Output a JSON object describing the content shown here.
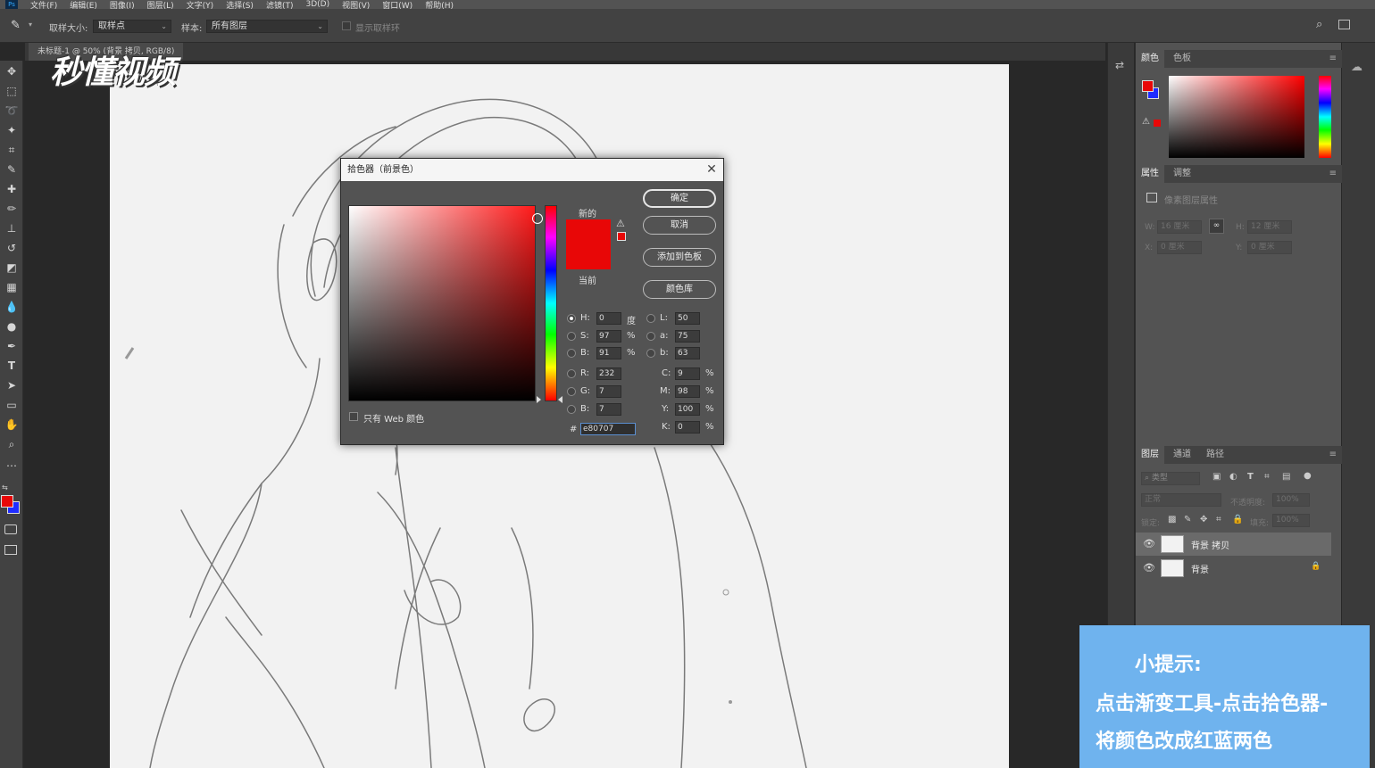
{
  "menubar": {
    "items": [
      "文件(F)",
      "编辑(E)",
      "图像(I)",
      "图层(L)",
      "文字(Y)",
      "选择(S)",
      "滤镜(T)",
      "3D(D)",
      "视图(V)",
      "窗口(W)",
      "帮助(H)"
    ]
  },
  "options_bar": {
    "sample_size_label": "取样大小:",
    "sample_size_value": "取样点",
    "sample_label": "样本:",
    "sample_value": "所有图层",
    "show_ring_label": "显示取样环"
  },
  "document": {
    "tab_label": "未标题-1 @ 50% (背景 拷贝, RGB/8)"
  },
  "watermark": {
    "text": "秒懂视频"
  },
  "color_picker": {
    "title": "拾色器（前景色）",
    "new_label": "新的",
    "current_label": "当前",
    "buttons": {
      "ok": "确定",
      "cancel": "取消",
      "add_to_swatches": "添加到色板",
      "color_libraries": "颜色库"
    },
    "only_web_colors_label": "只有 Web 颜色",
    "fields": {
      "H": {
        "label": "H:",
        "value": "0",
        "unit": "度"
      },
      "S": {
        "label": "S:",
        "value": "97",
        "unit": "%"
      },
      "B": {
        "label": "B:",
        "value": "91",
        "unit": "%"
      },
      "R": {
        "label": "R:",
        "value": "232"
      },
      "G": {
        "label": "G:",
        "value": "7"
      },
      "Bl": {
        "label": "B:",
        "value": "7"
      },
      "L": {
        "label": "L:",
        "value": "50"
      },
      "a": {
        "label": "a:",
        "value": "75"
      },
      "b": {
        "label": "b:",
        "value": "63"
      },
      "C": {
        "label": "C:",
        "value": "9",
        "unit": "%"
      },
      "M": {
        "label": "M:",
        "value": "98",
        "unit": "%"
      },
      "Y": {
        "label": "Y:",
        "value": "100",
        "unit": "%"
      },
      "K": {
        "label": "K:",
        "value": "0",
        "unit": "%"
      },
      "hex": {
        "label": "#",
        "value": "e80707"
      }
    },
    "selected_color": "#e80707"
  },
  "panels": {
    "color": {
      "tabs": [
        "颜色",
        "色板"
      ]
    },
    "properties": {
      "tabs": [
        "属性",
        "调整"
      ],
      "title": "像素图层属性",
      "w_label": "W:",
      "w_value": "16 厘米",
      "h_label": "H:",
      "h_value": "12 厘米",
      "x_label": "X:",
      "x_value": "0 厘米",
      "y_label": "Y:",
      "y_value": "0 厘米"
    },
    "layers": {
      "tabs": [
        "图层",
        "通道",
        "路径"
      ],
      "filter_label": "类型",
      "blend_mode": "正常",
      "opacity_label": "不透明度:",
      "opacity_value": "100%",
      "lock_label": "锁定:",
      "fill_label": "填充:",
      "fill_value": "100%",
      "items": [
        {
          "name": "背景 拷贝"
        },
        {
          "name": "背景"
        }
      ]
    }
  },
  "hint": {
    "title": "小提示:",
    "line1": "点击渐变工具-点击拾色器-",
    "line2": "将颜色改成红蓝两色"
  },
  "colors": {
    "foreground": "#e80707",
    "background": "#1f2cff",
    "hint_bg": "#6fb3ee"
  }
}
